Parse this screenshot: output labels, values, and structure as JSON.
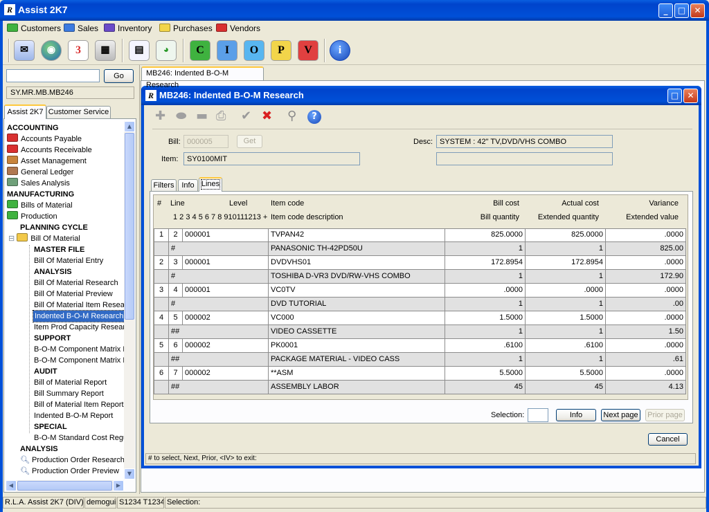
{
  "app": {
    "title": "Assist 2K7"
  },
  "menu": [
    {
      "label": "Customers",
      "color": "#3fb23f"
    },
    {
      "label": "Sales",
      "color": "#3c7be0"
    },
    {
      "label": "Inventory",
      "color": "#6a4bc8"
    },
    {
      "label": "Purchases",
      "color": "#f2d54a"
    },
    {
      "label": "Vendors",
      "color": "#d93030"
    }
  ],
  "toolbar": {
    "letters": [
      "C",
      "I",
      "O",
      "P",
      "V"
    ],
    "calendar_day": "3",
    "info_glyph": "i"
  },
  "search": {
    "value": "",
    "go_label": "Go",
    "path": "SY.MR.MB.MB246"
  },
  "left_tabs": [
    "Assist 2K7",
    "Customer Service"
  ],
  "tree": [
    {
      "label": "ACCOUNTING",
      "kind": "header"
    },
    {
      "label": "Accounts Payable",
      "kind": "folder",
      "color": "#d93030"
    },
    {
      "label": "Accounts Receivable",
      "kind": "folder",
      "color": "#d93030"
    },
    {
      "label": "Asset Management",
      "kind": "folder",
      "color": "#c8843c"
    },
    {
      "label": "General Ledger",
      "kind": "folder",
      "color": "#b07850"
    },
    {
      "label": "Sales Analysis",
      "kind": "folder",
      "color": "#6fa07a"
    },
    {
      "label": "MANUFACTURING",
      "kind": "header"
    },
    {
      "label": "Bills of Material",
      "kind": "folder",
      "color": "#3fb23f"
    },
    {
      "label": "Production",
      "kind": "folder",
      "color": "#3fb23f"
    },
    {
      "label": "PLANNING CYCLE",
      "kind": "subheader"
    },
    {
      "label": "Bill Of Material",
      "kind": "openfolder",
      "color": "#f2c94a"
    },
    {
      "label": "MASTER FILE",
      "kind": "leafheader"
    },
    {
      "label": "Bill Of Material Entry",
      "kind": "leaf"
    },
    {
      "label": "ANALYSIS",
      "kind": "leafheader"
    },
    {
      "label": "Bill Of Material Research",
      "kind": "leaf"
    },
    {
      "label": "Bill Of Material Preview",
      "kind": "leaf"
    },
    {
      "label": "Bill Of Material Item Resear",
      "kind": "leaf"
    },
    {
      "label": "Indented B-O-M Research",
      "kind": "selected"
    },
    {
      "label": "Item Prod Capacity Resear",
      "kind": "leaf"
    },
    {
      "label": "SUPPORT",
      "kind": "leafheader"
    },
    {
      "label": "B-O-M Component Matrix E",
      "kind": "leaf"
    },
    {
      "label": "B-O-M Component Matrix L",
      "kind": "leaf"
    },
    {
      "label": "AUDIT",
      "kind": "leafheader"
    },
    {
      "label": "Bill of Material Report",
      "kind": "leaf"
    },
    {
      "label": "Bill Summary Report",
      "kind": "leaf"
    },
    {
      "label": "Bill of Material Item Report",
      "kind": "leaf"
    },
    {
      "label": "Indented B-O-M Report",
      "kind": "leaf"
    },
    {
      "label": "SPECIAL",
      "kind": "leafheader"
    },
    {
      "label": "B-O-M Standard Cost Regu",
      "kind": "leaf"
    },
    {
      "label": "ANALYSIS",
      "kind": "subheader"
    },
    {
      "label": "Production Order Research",
      "kind": "search"
    },
    {
      "label": "Production Order Preview",
      "kind": "search"
    }
  ],
  "doc_tab": "MB246: Indented B-O-M Research",
  "dialog": {
    "title": "MB246: Indented B-O-M Research",
    "bill_label": "Bill:",
    "bill_value": "000005",
    "get_label": "Get",
    "item_label": "Item:",
    "item_value": "SY0100MIT",
    "desc_label": "Desc:",
    "desc_value": "SYSTEM : 42\" TV,DVD/VHS COMBO",
    "desc2_value": "",
    "tabs": [
      "Filters",
      "Info",
      "Lines"
    ],
    "active_tab": "Lines",
    "headers": {
      "num": "#",
      "line": "Line",
      "level": "Level",
      "item_code": "Item code",
      "bill_cost": "Bill cost",
      "actual_cost": "Actual cost",
      "variance": "Variance",
      "levels": "1 2 3 4 5 6 7 8 910111213 +",
      "item_desc": "Item code description",
      "bill_qty": "Bill quantity",
      "ext_qty": "Extended quantity",
      "ext_value": "Extended value"
    },
    "rows": [
      {
        "n": "1",
        "line": "2",
        "level": "000001",
        "item": "TVPAN42",
        "bill_cost": "825.0000",
        "actual_cost": "825.0000",
        "variance": ".0000",
        "marker": "#",
        "desc": "PANASONIC TH-42PD50U",
        "bill_qty": "1",
        "ext_qty": "1",
        "ext_value": "825.00"
      },
      {
        "n": "2",
        "line": "3",
        "level": "000001",
        "item": "DVDVHS01",
        "bill_cost": "172.8954",
        "actual_cost": "172.8954",
        "variance": ".0000",
        "marker": "#",
        "desc": "TOSHIBA D-VR3 DVD/RW-VHS COMBO",
        "bill_qty": "1",
        "ext_qty": "1",
        "ext_value": "172.90"
      },
      {
        "n": "3",
        "line": "4",
        "level": "000001",
        "item": "VC0TV",
        "bill_cost": ".0000",
        "actual_cost": ".0000",
        "variance": ".0000",
        "marker": "#",
        "desc": "DVD TUTORIAL",
        "bill_qty": "1",
        "ext_qty": "1",
        "ext_value": ".00"
      },
      {
        "n": "4",
        "line": "5",
        "level": "000002",
        "item": "VC000",
        "bill_cost": "1.5000",
        "actual_cost": "1.5000",
        "variance": ".0000",
        "marker": "##",
        "desc": "VIDEO CASSETTE",
        "bill_qty": "1",
        "ext_qty": "1",
        "ext_value": "1.50"
      },
      {
        "n": "5",
        "line": "6",
        "level": "000002",
        "item": "PK0001",
        "bill_cost": ".6100",
        "actual_cost": ".6100",
        "variance": ".0000",
        "marker": "##",
        "desc": "PACKAGE MATERIAL - VIDEO CASS",
        "bill_qty": "1",
        "ext_qty": "1",
        "ext_value": ".61"
      },
      {
        "n": "6",
        "line": "7",
        "level": "000002",
        "item": "**ASM",
        "bill_cost": "5.5000",
        "actual_cost": "5.5000",
        "variance": ".0000",
        "marker": "##",
        "desc": "ASSEMBLY LABOR",
        "bill_qty": "45",
        "ext_qty": "45",
        "ext_value": "4.13"
      }
    ],
    "selection_label": "Selection:",
    "selection_value": "",
    "info_label": "Info",
    "next_label": "Next page",
    "prior_label": "Prior page",
    "cancel_label": "Cancel",
    "hint": "# to select,  Next,  Prior,  <IV> to exit:"
  },
  "status": [
    "R.L.A. Assist 2K7 (DIV)",
    "demogui",
    "S1234 T1234",
    "Selection:"
  ]
}
